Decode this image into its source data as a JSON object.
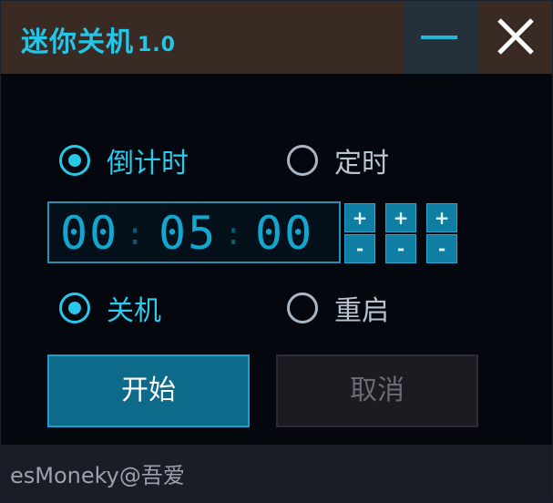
{
  "title": {
    "name": "迷你关机",
    "version": "1.0"
  },
  "window_controls": {
    "minimize_icon": "minimize-icon",
    "close_icon": "close-icon"
  },
  "mode": {
    "options": [
      {
        "label": "倒计时",
        "selected": true
      },
      {
        "label": "定时",
        "selected": false
      }
    ]
  },
  "timer": {
    "hours": "00",
    "minutes": "05",
    "seconds": "00",
    "separator": ":"
  },
  "steppers": {
    "plus": "+",
    "minus": "-"
  },
  "action": {
    "options": [
      {
        "label": "关机",
        "selected": true
      },
      {
        "label": "重启",
        "selected": false
      }
    ]
  },
  "buttons": {
    "start": "开始",
    "cancel": "取消"
  },
  "footer": {
    "text": "esMoneky@吾爱"
  },
  "colors": {
    "accent": "#27c8e8",
    "titlebar": "#3a2a24",
    "background": "#05070e",
    "button": "#0d6a8a"
  }
}
